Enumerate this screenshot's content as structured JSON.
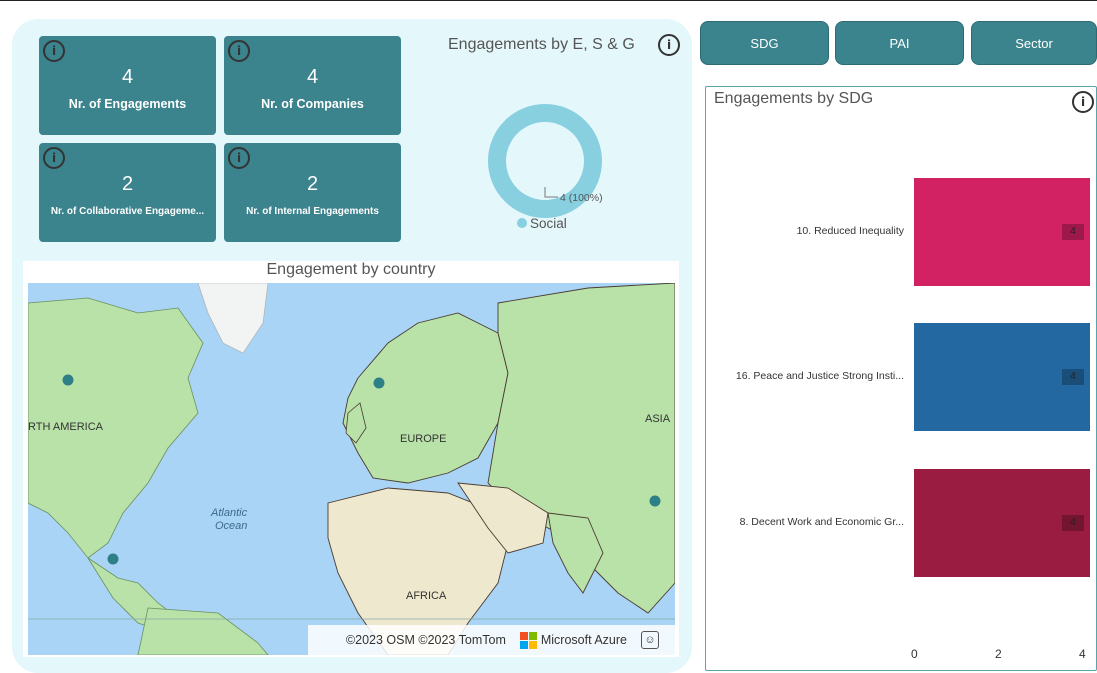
{
  "kpis": [
    {
      "value": "4",
      "label": "Nr. of Engagements"
    },
    {
      "value": "4",
      "label": "Nr. of Companies"
    },
    {
      "value": "2",
      "label": "Nr. of Collaborative Engageme..."
    },
    {
      "value": "2",
      "label": "Nr. of Internal Engagements"
    }
  ],
  "info_glyph": "i",
  "donut": {
    "title": "Engagements by E, S & G",
    "data_label": "4 (100%)",
    "legend": "Social",
    "color": "#88cfe0"
  },
  "map": {
    "title": "Engagement by country",
    "labels": {
      "north_america": "RTH AMERICA",
      "europe": "EUROPE",
      "asia": "ASIA",
      "africa": "AFRICA",
      "atlantic": "Atlantic",
      "ocean": "Ocean"
    },
    "copyright": "©2023 OSM  ©2023 TomTom",
    "brand": "Microsoft Azure",
    "feedback_glyph": "☺"
  },
  "tabs": [
    "SDG",
    "PAI",
    "Sector"
  ],
  "sdg_chart": {
    "title": "Engagements by SDG",
    "chart_data": {
      "type": "bar",
      "orientation": "horizontal",
      "title": "Engagements by SDG",
      "categories": [
        "10. Reduced Inequality",
        "16. Peace and Justice Strong Insti...",
        "8. Decent Work and Economic Gr..."
      ],
      "values": [
        4,
        4,
        4
      ],
      "colors": [
        "#d32264",
        "#2368a0",
        "#9a1c40"
      ],
      "xlim": [
        0,
        4
      ],
      "xticks": [
        "0",
        "2",
        "4"
      ],
      "grid": false,
      "legend": "none"
    }
  },
  "colors": {
    "accent": "#3b838d",
    "panel": "#e4f7fb"
  }
}
